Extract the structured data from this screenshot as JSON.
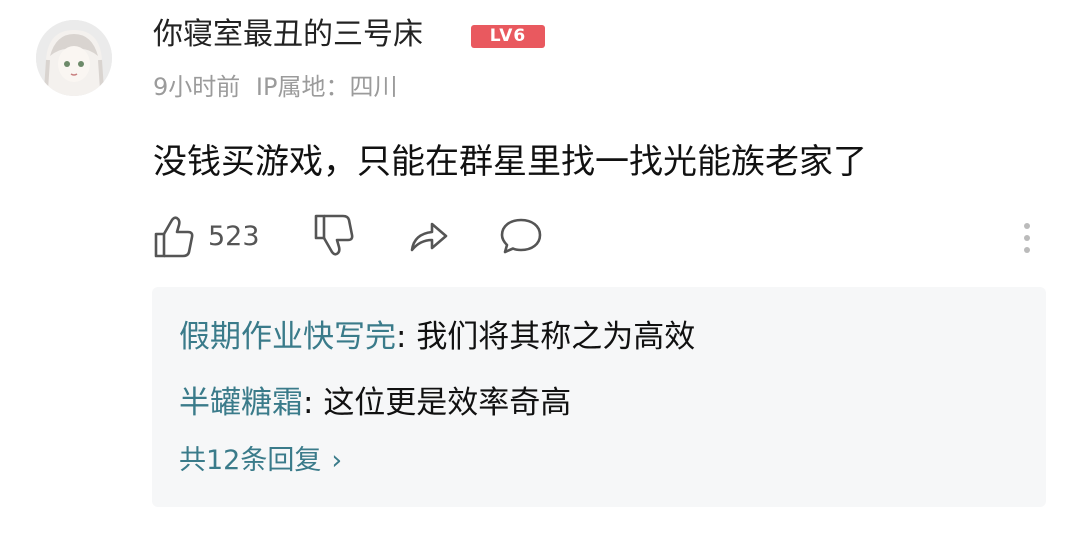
{
  "comment": {
    "username": "你寝室最丑的三号床",
    "level": "LV6",
    "time": "9小时前",
    "ip_location": "IP属地：四川",
    "text": "没钱买游戏，只能在群星里找一找光能族老家了",
    "likes": "523"
  },
  "replies": {
    "items": [
      {
        "author": "假期作业快写完",
        "separator": ": ",
        "text": "我们将其称之为高效"
      },
      {
        "author": "半罐糖霜",
        "separator": ": ",
        "text": "这位更是效率奇高"
      }
    ],
    "total_label": "共12条回复",
    "chevron": "›"
  },
  "colors": {
    "reply_author": "#3a7b8a",
    "level_badge": "#e9595f"
  },
  "icons": [
    "thumbs-up-icon",
    "thumbs-down-icon",
    "share-icon",
    "comment-icon",
    "more-vertical-icon"
  ]
}
